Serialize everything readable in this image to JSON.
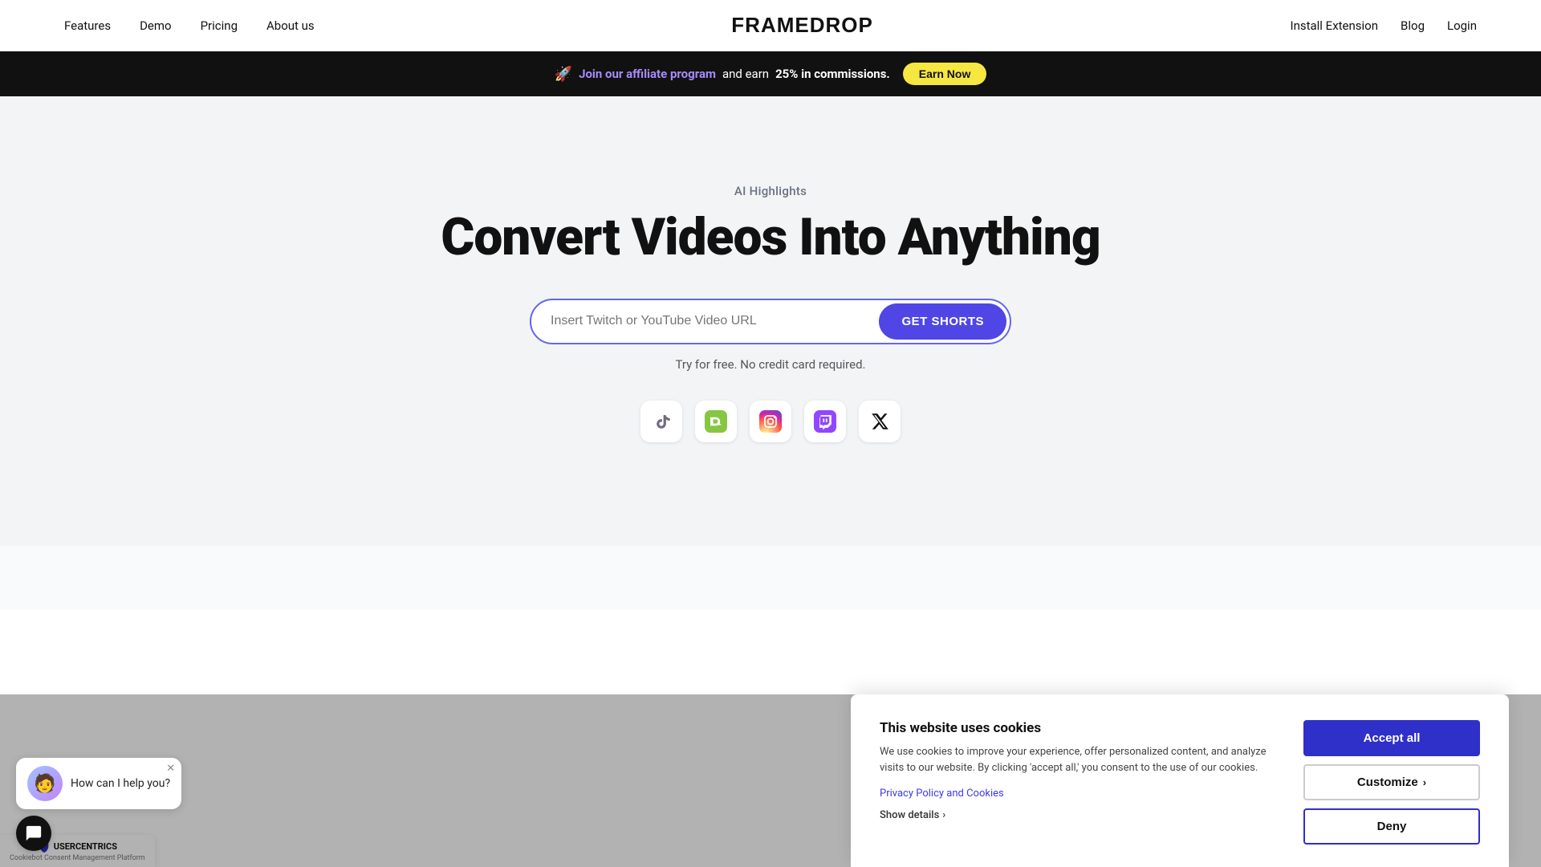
{
  "nav": {
    "links_left": [
      "Features",
      "Demo",
      "Pricing",
      "About us"
    ],
    "logo": "FRAMEDROP",
    "links_right": [
      "Install Extension",
      "Blog",
      "Login"
    ]
  },
  "banner": {
    "rocket_emoji": "🚀",
    "affiliate_text": "Join our affiliate program",
    "middle_text": " and earn ",
    "bold_text": "25% in commissions.",
    "cta_label": "Earn Now"
  },
  "hero": {
    "sub_label": "AI Highlights",
    "title": "Convert Videos Into Anything",
    "input_placeholder": "Insert Twitch or YouTube Video URL",
    "button_label": "GET SHORTS",
    "caption": "Try for free. No credit card required.",
    "social_icons": [
      {
        "name": "tiktok",
        "emoji": "🎵"
      },
      {
        "name": "rumble",
        "emoji": "📹"
      },
      {
        "name": "instagram",
        "emoji": "📷"
      },
      {
        "name": "twitch",
        "emoji": "💜"
      },
      {
        "name": "x-twitter",
        "emoji": "✖"
      }
    ]
  },
  "cookie": {
    "title": "This website uses cookies",
    "description": "We use cookies to improve your experience, offer personalized content, and analyze visits to our website. By clicking 'accept all,' you consent to the use of our cookies.",
    "privacy_link_text": "Privacy Policy and Cookies",
    "show_details_text": "Show details",
    "accept_label": "Accept all",
    "customize_label": "Customize",
    "deny_label": "Deny"
  },
  "chat": {
    "message": "How can I help you?"
  },
  "usercentrics": {
    "logo_text": "USERCENTRICS",
    "sub_text": "Cookiebot Consent Management Platform"
  },
  "colors": {
    "accent_purple": "#4f46e5",
    "banner_bg": "#111111",
    "earn_btn_bg": "#f5e642",
    "hero_bg": "#f3f4f6"
  }
}
